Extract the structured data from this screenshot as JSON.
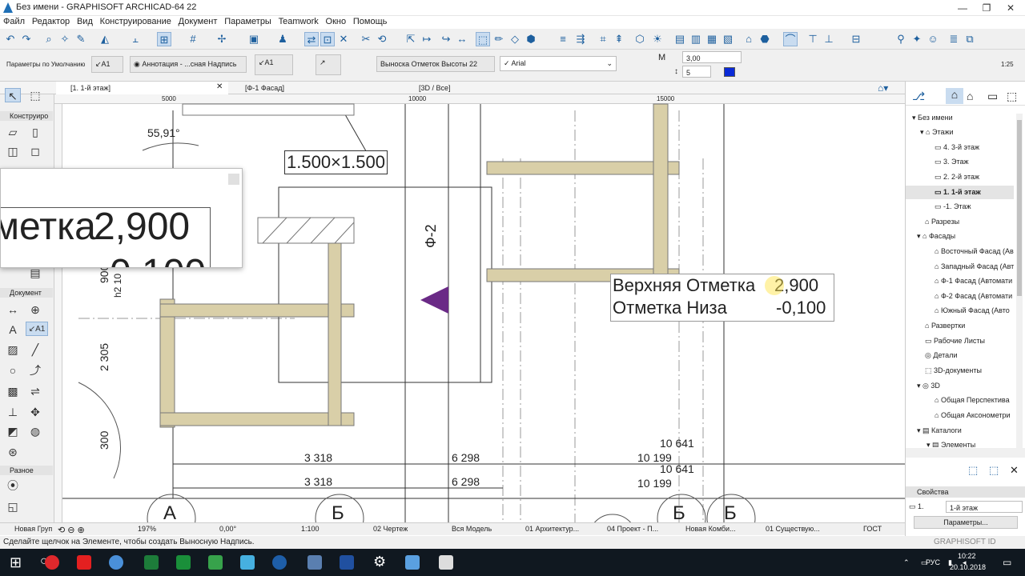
{
  "window": {
    "title": "Без имени - GRAPHISOFT ARCHICAD-64 22",
    "min": "—",
    "max": "❐",
    "close": "✕"
  },
  "menu": [
    "Файл",
    "Редактор",
    "Вид",
    "Конструирование",
    "Документ",
    "Параметры",
    "Teamwork",
    "Окно",
    "Помощь"
  ],
  "infobox": {
    "defaults": "Параметры по Умолчанию",
    "tool": "A1",
    "layer": "Аннотация - ...сная Надпись",
    "label_type": "Выноска Отметок Высоты 22",
    "font": "Arial",
    "size": "3,00",
    "spacing": "5",
    "bold": "Ж",
    "italic": "К",
    "underline": "П",
    "strike": "З",
    "scale_hint": "1:25"
  },
  "tabs": [
    {
      "label": "[1. 1-й этаж]"
    },
    {
      "label": "[Ф-1 Фасад]"
    },
    {
      "label": "[3D / Все]"
    }
  ],
  "tab_close": "✕",
  "tool_sections": {
    "design": "Конструиро",
    "document": "Документ",
    "misc": "Разное"
  },
  "drawing": {
    "ruler": [
      "5000",
      "10000",
      "15000"
    ],
    "angle": "55,91°",
    "window_size": "1.500×1.500",
    "elev_label": "Ф-2",
    "callout_line1": "Верхняя Отметка",
    "callout_val1": "2,900",
    "callout_line2": "Отметка Низа",
    "callout_val2": "-0,100",
    "zoom_line1": "метка",
    "zoom_val1": "2,900",
    "zoom_line2": "0,100",
    "dims": [
      "3 318",
      "3 318",
      "6 298",
      "6 298",
      "10 641",
      "10 199",
      "10 641",
      "10 199"
    ],
    "vdims": [
      "900",
      "h2 10",
      "2 305",
      "300"
    ],
    "grid": [
      "А",
      "Б",
      "Б",
      "Б"
    ]
  },
  "navigator": {
    "root": "Без имени",
    "stories": "Этажи",
    "story_items": [
      "4. 3-й этаж",
      "3. Этаж",
      "2. 2-й этаж",
      "1. 1-й этаж",
      "-1. Этаж"
    ],
    "sections": "Разрезы",
    "elevations": "Фасады",
    "elev_items": [
      "Восточный Фасад (Ав",
      "Западный Фасад (Авт",
      "Ф-1 Фасад (Автомати",
      "Ф-2 Фасад (Автомати",
      "Южный Фасад (Авто"
    ],
    "details1": "Развертки",
    "worksheets": "Рабочие Листы",
    "details": "Детали",
    "docs3d": "3D-документы",
    "d3": "3D",
    "persp": "Общая Перспектива",
    "axon": "Общая Аксонометри",
    "schedules": "Каталоги",
    "elements": "Элементы"
  },
  "properties": {
    "header": "Свойства",
    "id": "1.",
    "value": "1-й этаж",
    "button": "Параметры..."
  },
  "status": {
    "group": "Новая Груп",
    "zoom": "197%",
    "angle": "0,00°",
    "scale": "1:100",
    "layer": "02 Чертеж",
    "model": "Вся Модель",
    "arch": "01 Архитектур...",
    "proj": "04 Проект - П...",
    "combo": "Новая Комби...",
    "exist": "01 Существую...",
    "std": "ГОСТ"
  },
  "hint": "Сделайте щелчок на Элементе, чтобы создать Выносную Надпись.",
  "brand": "GRAPHISOFT ID",
  "tray": {
    "lang": "РУС",
    "time": "10:22",
    "date": "20.10.2018"
  },
  "colors": {
    "wall": "#d9cfa8",
    "accent": "#6a2a86",
    "taskbar": "#101820"
  }
}
